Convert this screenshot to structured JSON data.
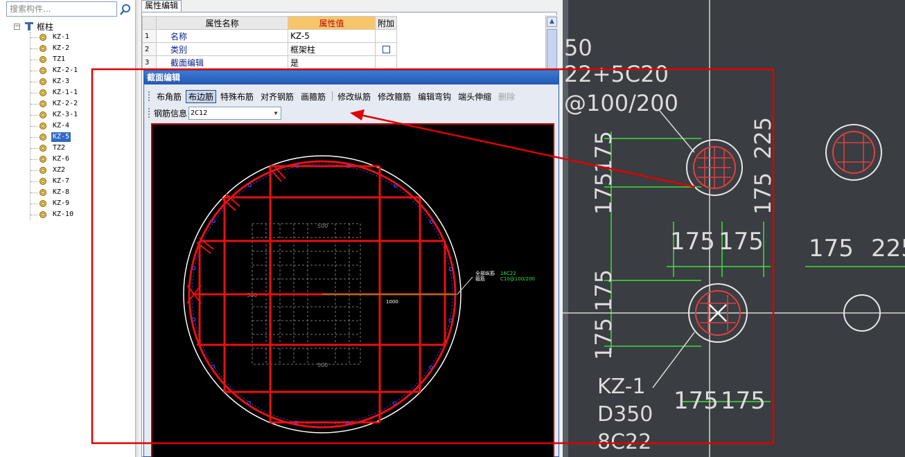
{
  "search": {
    "placeholder": "搜索构件..."
  },
  "tree": {
    "root_label": "框柱",
    "items": [
      "KZ-1",
      "KZ-2",
      "TZ1",
      "KZ-2-1",
      "KZ-3",
      "KZ-1-1",
      "KZ-2-2",
      "KZ-3-1",
      "KZ-4",
      "KZ-5",
      "TZ2",
      "KZ-6",
      "XZ2",
      "KZ-7",
      "KZ-8",
      "KZ-9",
      "KZ-10"
    ],
    "selected": "KZ-5"
  },
  "property_panel": {
    "tab_label": "属性编辑",
    "headers": {
      "name": "属性名称",
      "value": "属性值",
      "extra": "附加"
    },
    "rows": [
      {
        "num": "1",
        "name": "名称",
        "value": "KZ-5"
      },
      {
        "num": "2",
        "name": "类别",
        "value": "框架柱"
      },
      {
        "num": "3",
        "name": "截面编辑",
        "value": "是"
      }
    ]
  },
  "dialog": {
    "title": "截面编辑",
    "toolbar": [
      "布角筋",
      "布边筋",
      "特殊布筋",
      "对齐钢筋",
      "画箍筋",
      "修改纵筋",
      "修改箍筋",
      "编辑弯钩",
      "端头伸缩",
      "删除"
    ],
    "active_tool": "布边筋",
    "rebar_label": "钢筋信息",
    "rebar_value": "2C12"
  },
  "canvas": {
    "dim_top": "500",
    "dim_left": "500",
    "dim_bottom": "500",
    "dim_length": "1000",
    "annotation_line1_label": "全部纵筋",
    "annotation_line1_value": "16C22",
    "annotation_line2_label": "箍筋",
    "annotation_line2_value": "C10@100/200"
  },
  "photo_texts": {
    "t1": "50",
    "t2": "22+5C20",
    "t3": "@100/200",
    "d175a": "175",
    "d175b": "175",
    "d225a": "225",
    "d175c": "175",
    "d175d": "175",
    "d175e": "175",
    "d175f": "175",
    "d225b": "225",
    "d175g": "175",
    "d175h": "175",
    "d175i": "175",
    "d175j": "175",
    "name": "KZ-1",
    "dia": "D350",
    "bars": "8C22"
  },
  "colors": {
    "accent_red": "#e00000",
    "rebar_red": "#e81010",
    "grid_green": "#3ce03c",
    "title_blue": "#2358b4"
  }
}
